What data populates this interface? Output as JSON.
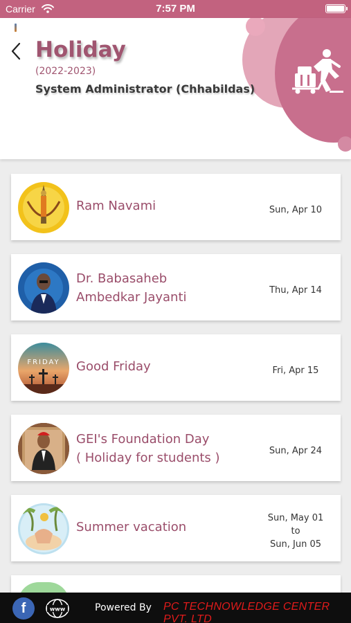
{
  "status_bar": {
    "carrier": "Carrier",
    "time": "7:57 PM"
  },
  "header": {
    "title": "Holiday",
    "subtitle": "(2022-2023)",
    "user": "System Administrator (Chhabildas)",
    "icon": "person-pushing-luggage-icon"
  },
  "holidays": [
    {
      "name_line1": "Ram Navami",
      "name_line2": "",
      "date_line1": "Sun, Apr 10",
      "date_line2": "",
      "date_line3": ""
    },
    {
      "name_line1": "Dr. Babasaheb",
      "name_line2": "Ambedkar Jayanti",
      "date_line1": "Thu, Apr 14",
      "date_line2": "",
      "date_line3": ""
    },
    {
      "name_line1": "Good Friday",
      "name_line2": "",
      "date_line1": "Fri, Apr 15",
      "date_line2": "",
      "date_line3": ""
    },
    {
      "name_line1": "GEI's Foundation Day",
      "name_line2": "( Holiday for students )",
      "date_line1": "Sun, Apr 24",
      "date_line2": "",
      "date_line3": ""
    },
    {
      "name_line1": "Summer vacation",
      "name_line2": "",
      "date_line1": "Sun, May 01",
      "date_line2": "to",
      "date_line3": "Sun, Jun 05"
    }
  ],
  "avatar_text": {
    "good_friday": "FRIDAY"
  },
  "footer": {
    "facebook": "f",
    "powered_by": "Powered By",
    "company": "PC TECHNOWLEDGE CENTER PVT. LTD"
  },
  "colors": {
    "accent": "#c86f8d",
    "title": "#a05570",
    "status_bar": "#c2627f",
    "company": "#e11b1b"
  }
}
